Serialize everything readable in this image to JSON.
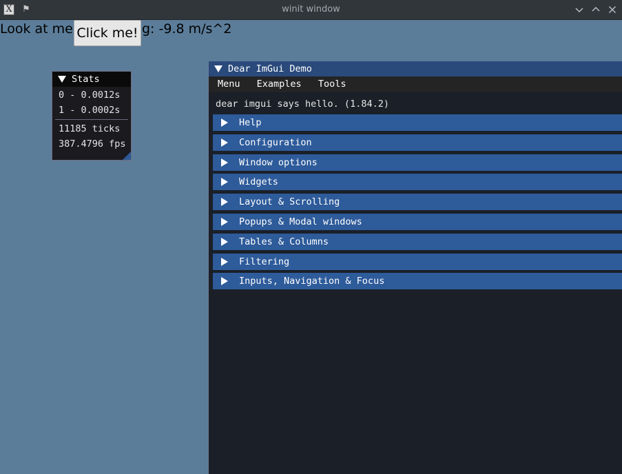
{
  "window": {
    "title": "winit window",
    "icon": "app-logo-icon",
    "controls": [
      "pin-icon",
      "minimize-icon",
      "maximize-icon",
      "close-icon"
    ]
  },
  "top": {
    "label": "Look at me!",
    "button_label": "Click me!",
    "gravity_text": "g: -9.8 m/s^2"
  },
  "stats": {
    "title": "Stats",
    "lines": [
      "0 - 0.0012s",
      "1 - 0.0002s"
    ],
    "ticks": "11185 ticks",
    "fps": "387.4796 fps"
  },
  "demo": {
    "title": "Dear ImGui Demo",
    "menu": [
      "Menu",
      "Examples",
      "Tools"
    ],
    "hello": "dear imgui says hello. (1.84.2)",
    "sections": [
      "Help",
      "Configuration",
      "Window options",
      "Widgets",
      "Layout & Scrolling",
      "Popups & Modal windows",
      "Tables & Columns",
      "Filtering",
      "Inputs, Navigation & Focus"
    ]
  },
  "colors": {
    "desktop": "#5c7d99",
    "imgui_header": "#2e5b9a",
    "imgui_title": "#2a4a7c",
    "imgui_bg": "#1a1f28"
  }
}
